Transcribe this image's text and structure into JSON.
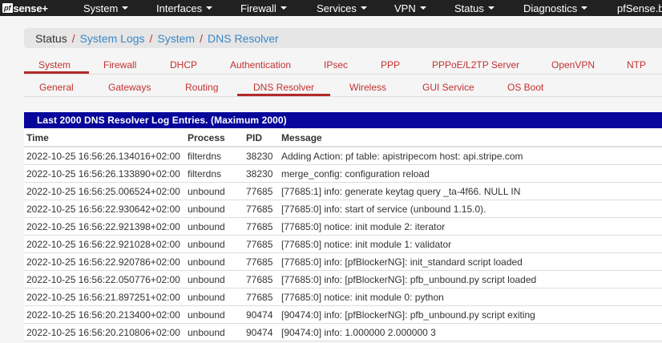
{
  "navbar": {
    "logo_box": "pf",
    "logo_text": "sense",
    "logo_plus": "+",
    "items": [
      {
        "label": "System"
      },
      {
        "label": "Interfaces"
      },
      {
        "label": "Firewall"
      },
      {
        "label": "Services"
      },
      {
        "label": "VPN"
      },
      {
        "label": "Status"
      },
      {
        "label": "Diagnostics"
      },
      {
        "label": "pfSense.b"
      }
    ]
  },
  "breadcrumb": {
    "status": "Status",
    "sep": "/",
    "items": [
      "System Logs",
      "System",
      "DNS Resolver"
    ]
  },
  "tabs_row1": [
    "System",
    "Firewall",
    "DHCP",
    "Authentication",
    "IPsec",
    "PPP",
    "PPPoE/L2TP Server",
    "OpenVPN",
    "NTP"
  ],
  "tabs_row2": [
    "General",
    "Gateways",
    "Routing",
    "DNS Resolver",
    "Wireless",
    "GUI Service",
    "OS Boot"
  ],
  "panel": {
    "title": "Last 2000 DNS Resolver Log Entries. (Maximum 2000)",
    "columns": {
      "time": "Time",
      "process": "Process",
      "pid": "PID",
      "message": "Message"
    },
    "rows": [
      {
        "time": "2022-10-25 16:56:26.134016+02:00",
        "process": "filterdns",
        "pid": "38230",
        "message": "Adding Action: pf table: apistripecom host: api.stripe.com"
      },
      {
        "time": "2022-10-25 16:56:26.133890+02:00",
        "process": "filterdns",
        "pid": "38230",
        "message": "merge_config: configuration reload"
      },
      {
        "time": "2022-10-25 16:56:25.006524+02:00",
        "process": "unbound",
        "pid": "77685",
        "message": "[77685:1] info: generate keytag query _ta-4f66. NULL IN"
      },
      {
        "time": "2022-10-25 16:56:22.930642+02:00",
        "process": "unbound",
        "pid": "77685",
        "message": "[77685:0] info: start of service (unbound 1.15.0)."
      },
      {
        "time": "2022-10-25 16:56:22.921398+02:00",
        "process": "unbound",
        "pid": "77685",
        "message": "[77685:0] notice: init module 2: iterator"
      },
      {
        "time": "2022-10-25 16:56:22.921028+02:00",
        "process": "unbound",
        "pid": "77685",
        "message": "[77685:0] notice: init module 1: validator"
      },
      {
        "time": "2022-10-25 16:56:22.920786+02:00",
        "process": "unbound",
        "pid": "77685",
        "message": "[77685:0] info: [pfBlockerNG]: init_standard script loaded"
      },
      {
        "time": "2022-10-25 16:56:22.050776+02:00",
        "process": "unbound",
        "pid": "77685",
        "message": "[77685:0] info: [pfBlockerNG]: pfb_unbound.py script loaded"
      },
      {
        "time": "2022-10-25 16:56:21.897251+02:00",
        "process": "unbound",
        "pid": "77685",
        "message": "[77685:0] notice: init module 0: python"
      },
      {
        "time": "2022-10-25 16:56:20.213400+02:00",
        "process": "unbound",
        "pid": "90474",
        "message": "[90474:0] info: [pfBlockerNG]: pfb_unbound.py script exiting"
      },
      {
        "time": "2022-10-25 16:56:20.210806+02:00",
        "process": "unbound",
        "pid": "90474",
        "message": "[90474:0] info: 1.000000 2.000000 3"
      }
    ]
  },
  "colors": {
    "navbar": "#212121",
    "accent": "#c43030",
    "panel_header": "#06069a",
    "link": "#3a87c7"
  }
}
